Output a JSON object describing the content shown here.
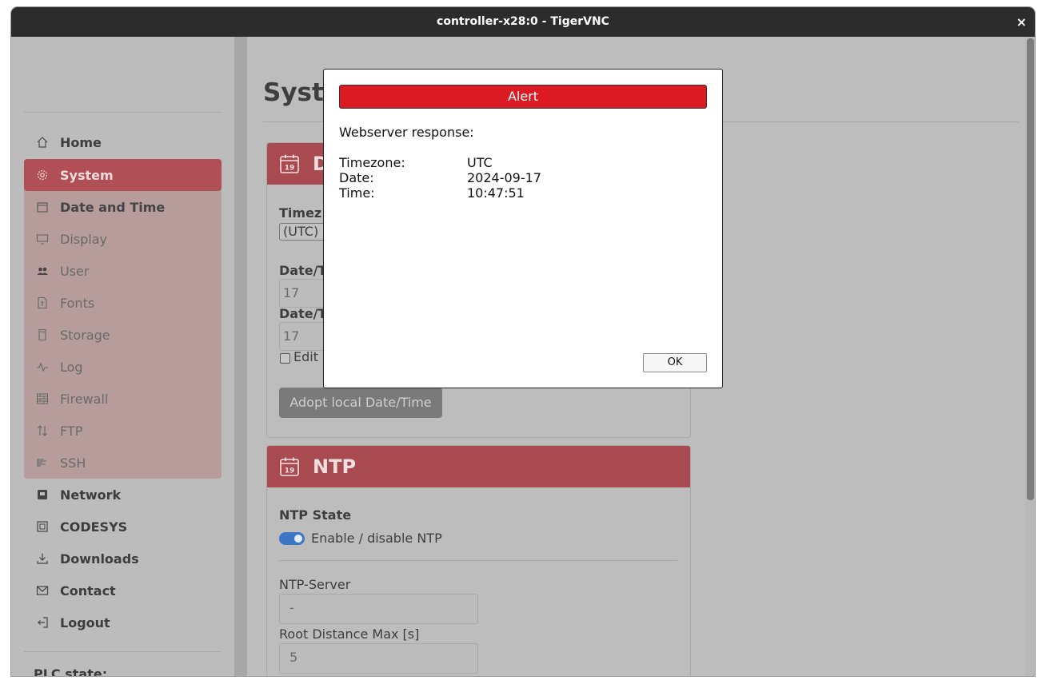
{
  "window": {
    "title": "controller-x28:0 - TigerVNC",
    "close_glyph": "×"
  },
  "sidebar": {
    "items": [
      {
        "label": "Home",
        "icon": "home-icon"
      },
      {
        "label": "System",
        "icon": "gear-icon"
      },
      {
        "label": "Date and Time",
        "icon": "calendar-icon"
      },
      {
        "label": "Display",
        "icon": "monitor-icon"
      },
      {
        "label": "User",
        "icon": "users-icon"
      },
      {
        "label": "Fonts",
        "icon": "font-file-icon"
      },
      {
        "label": "Storage",
        "icon": "sd-card-icon"
      },
      {
        "label": "Log",
        "icon": "pulse-icon"
      },
      {
        "label": "Firewall",
        "icon": "brick-wall-icon"
      },
      {
        "label": "FTP",
        "icon": "transfer-arrows-icon"
      },
      {
        "label": "SSH",
        "icon": "terminal-icon"
      },
      {
        "label": "Network",
        "icon": "network-icon"
      },
      {
        "label": "CODESYS",
        "icon": "chip-icon"
      },
      {
        "label": "Downloads",
        "icon": "download-icon"
      },
      {
        "label": "Contact",
        "icon": "envelope-icon"
      },
      {
        "label": "Logout",
        "icon": "logout-icon"
      }
    ],
    "plc_state_label": "PLC state:"
  },
  "main": {
    "page_title": "Syste",
    "date_card": {
      "header": "D",
      "calendar_day": "19",
      "timezone_label": "Timez",
      "timezone_value": "(UTC)",
      "date_label_1": "Date/T",
      "date_value_1": "17",
      "date_label_2": "Date/T",
      "date_value_2": "17",
      "edit_label": "Edit",
      "adopt_button": "Adopt local Date/Time"
    },
    "ntp_card": {
      "header": "NTP",
      "calendar_day": "19",
      "state_label": "NTP State",
      "toggle_label": "Enable / disable NTP",
      "toggle_on": true,
      "server_label": "NTP-Server",
      "server_value": "-",
      "root_distance_label": "Root Distance Max [s]",
      "root_distance_value": "5"
    }
  },
  "dialog": {
    "title": "Alert",
    "message": "Webserver response:",
    "rows": [
      {
        "key": "Timezone:",
        "value": "UTC"
      },
      {
        "key": "Date:",
        "value": "2024-09-17"
      },
      {
        "key": "Time:",
        "value": "10:47:51"
      }
    ],
    "ok_label": "OK"
  },
  "colors": {
    "accent_active": "#b04f55",
    "alert_red": "#dc1a24",
    "toggle_blue": "#3d76c4"
  }
}
